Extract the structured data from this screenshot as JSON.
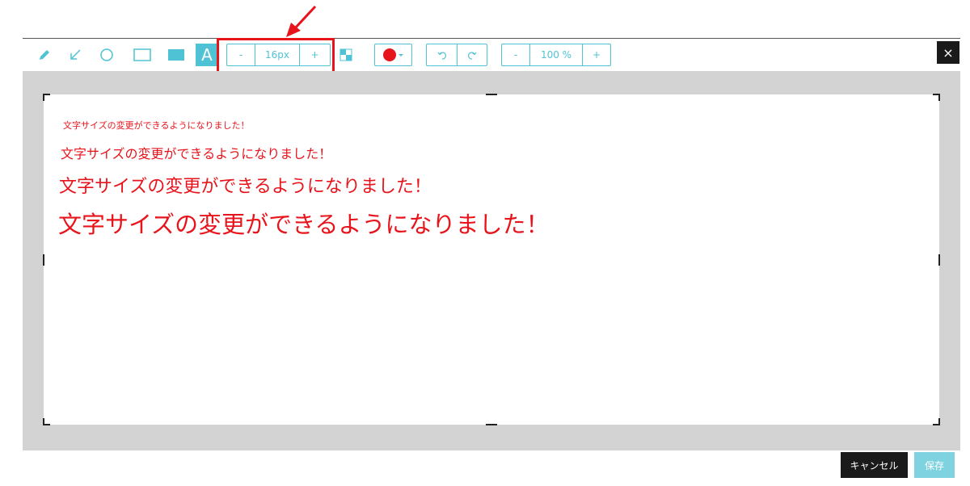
{
  "toolbar": {
    "tools": [
      {
        "name": "pencil-icon"
      },
      {
        "name": "arrow-icon"
      },
      {
        "name": "circle-icon"
      },
      {
        "name": "rectangle-icon"
      },
      {
        "name": "filled-rectangle-icon"
      },
      {
        "name": "text-tool",
        "label": "A",
        "active": true
      }
    ],
    "font_size": {
      "minus": "-",
      "value": "16px",
      "plus": "+"
    },
    "color": {
      "selected": "#e8141c"
    },
    "zoom": {
      "minus": "-",
      "value": "100 %",
      "plus": "+"
    },
    "close_label": "×"
  },
  "canvas": {
    "texts": [
      "文字サイズの変更ができるようになりました！",
      "文字サイズの変更ができるようになりました！",
      "文字サイズの変更ができるようになりました！",
      "文字サイズの変更ができるようになりました！"
    ]
  },
  "footer": {
    "cancel_label": "キャンセル",
    "save_label": "保存"
  },
  "colors": {
    "accent": "#4fc3d5",
    "annotation_red": "#e8141c"
  }
}
